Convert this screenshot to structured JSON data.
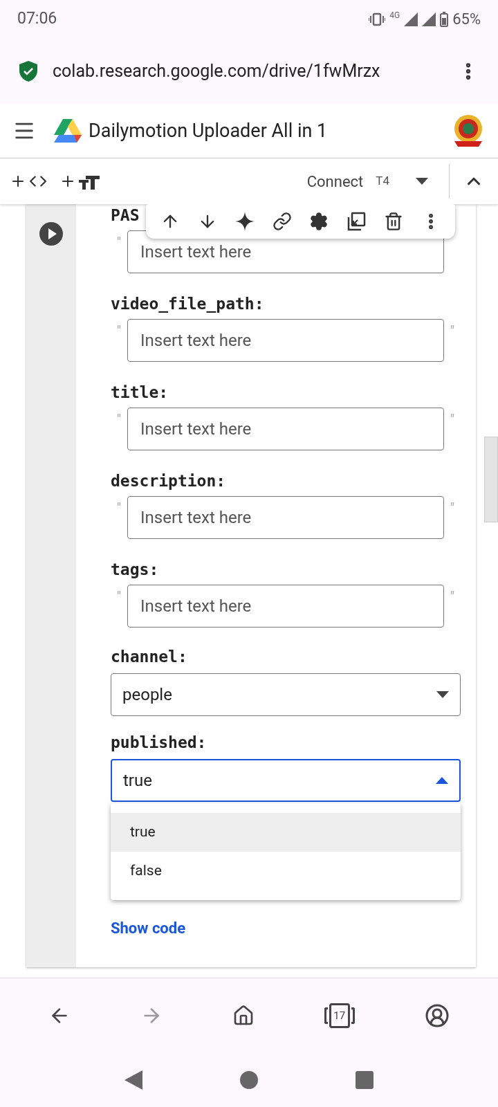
{
  "status_bar": {
    "time": "07:06",
    "network": "4G",
    "battery": "65%"
  },
  "browser": {
    "url": "colab.research.google.com/drive/1fwMrzx"
  },
  "notebook": {
    "title": "Dailymotion Uploader All in 1"
  },
  "toolbar": {
    "connect": "Connect",
    "runtime": "T4"
  },
  "form": {
    "fields": [
      {
        "kind": "text",
        "label": "PAS",
        "placeholder": "Insert text here",
        "open_quote": "\""
      },
      {
        "kind": "text",
        "label": "video_file_path:",
        "placeholder": "Insert text here",
        "open_quote": "\"",
        "close_quote": "\""
      },
      {
        "kind": "text",
        "label": "title:",
        "placeholder": "Insert text here",
        "open_quote": "\"",
        "close_quote": "\""
      },
      {
        "kind": "text",
        "label": "description:",
        "placeholder": "Insert text here",
        "open_quote": "\"",
        "close_quote": "\""
      },
      {
        "kind": "text",
        "label": "tags:",
        "placeholder": "Insert text here",
        "open_quote": "\"",
        "close_quote": "\""
      },
      {
        "kind": "select",
        "label": "channel:",
        "value": "people",
        "open": false
      },
      {
        "kind": "select",
        "label": "published:",
        "value": "true",
        "open": true,
        "options": [
          {
            "label": "true",
            "selected": true
          },
          {
            "label": "false",
            "selected": false
          }
        ]
      }
    ],
    "show_code": "Show code"
  },
  "bottom_nav": {
    "forward_disabled": true,
    "tab_count": "17"
  }
}
